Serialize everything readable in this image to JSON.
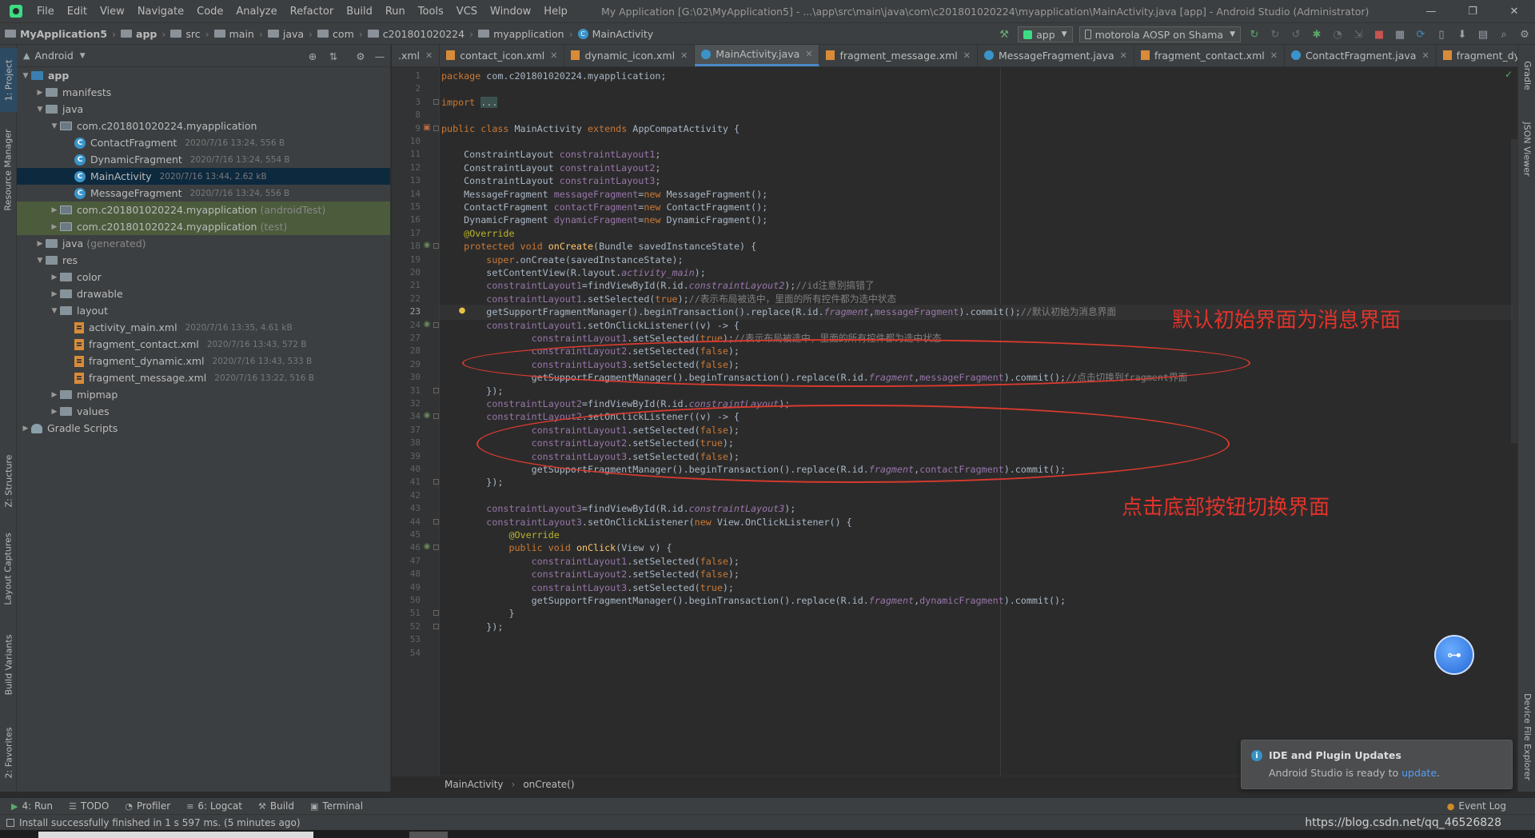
{
  "menubar": {
    "items": [
      "File",
      "Edit",
      "View",
      "Navigate",
      "Code",
      "Analyze",
      "Refactor",
      "Build",
      "Run",
      "Tools",
      "VCS",
      "Window",
      "Help"
    ],
    "window_title": "My Application [G:\\02\\MyApplication5] - ...\\app\\src\\main\\java\\com\\c201801020224\\myapplication\\MainActivity.java [app] - Android Studio (Administrator)",
    "controls": [
      "—",
      "❐",
      "✕"
    ]
  },
  "navbar": {
    "crumbs": [
      "MyApplication5",
      "app",
      "src",
      "main",
      "java",
      "com",
      "c201801020224",
      "myapplication",
      "MainActivity"
    ],
    "run_config": "app",
    "device": "motorola AOSP on Shama"
  },
  "left_strip": {
    "tabs": [
      "1: Project",
      "Resource Manager",
      "Z: Structure",
      "Layout Captures",
      "Build Variants",
      "2: Favorites"
    ]
  },
  "right_strip": {
    "tabs": [
      "Gradle",
      "JSON Viewer",
      "Device File Explorer"
    ]
  },
  "project": {
    "view": "Android",
    "tree": [
      {
        "label": "app",
        "meta": "",
        "suffix": "",
        "level": 0,
        "arrow": "▼",
        "icon": "folder-blue",
        "state": "",
        "bold": true
      },
      {
        "label": "manifests",
        "meta": "",
        "suffix": "",
        "level": 1,
        "arrow": "▶",
        "icon": "folder",
        "state": ""
      },
      {
        "label": "java",
        "meta": "",
        "suffix": "",
        "level": 1,
        "arrow": "▼",
        "icon": "folder",
        "state": ""
      },
      {
        "label": "com.c201801020224.myapplication",
        "meta": "",
        "suffix": "",
        "level": 2,
        "arrow": "▼",
        "icon": "package",
        "state": ""
      },
      {
        "label": "ContactFragment",
        "meta": "2020/7/16 13:24, 556 B",
        "suffix": "",
        "level": 3,
        "arrow": "",
        "icon": "class",
        "state": ""
      },
      {
        "label": "DynamicFragment",
        "meta": "2020/7/16 13:24, 554 B",
        "suffix": "",
        "level": 3,
        "arrow": "",
        "icon": "class",
        "state": ""
      },
      {
        "label": "MainActivity",
        "meta": "2020/7/16 13:44, 2.62 kB",
        "suffix": "",
        "level": 3,
        "arrow": "",
        "icon": "class",
        "state": "sel"
      },
      {
        "label": "MessageFragment",
        "meta": "2020/7/16 13:24, 556 B",
        "suffix": "",
        "level": 3,
        "arrow": "",
        "icon": "class",
        "state": ""
      },
      {
        "label": "com.c201801020224.myapplication",
        "meta": "",
        "suffix": "(androidTest)",
        "level": 2,
        "arrow": "▶",
        "icon": "package",
        "state": "hl"
      },
      {
        "label": "com.c201801020224.myapplication",
        "meta": "",
        "suffix": "(test)",
        "level": 2,
        "arrow": "▶",
        "icon": "package",
        "state": "hl"
      },
      {
        "label": "java",
        "meta": "",
        "suffix": "(generated)",
        "level": 1,
        "arrow": "▶",
        "icon": "folder",
        "state": ""
      },
      {
        "label": "res",
        "meta": "",
        "suffix": "",
        "level": 1,
        "arrow": "▼",
        "icon": "folder",
        "state": ""
      },
      {
        "label": "color",
        "meta": "",
        "suffix": "",
        "level": 2,
        "arrow": "▶",
        "icon": "folder",
        "state": ""
      },
      {
        "label": "drawable",
        "meta": "",
        "suffix": "",
        "level": 2,
        "arrow": "▶",
        "icon": "folder",
        "state": ""
      },
      {
        "label": "layout",
        "meta": "",
        "suffix": "",
        "level": 2,
        "arrow": "▼",
        "icon": "folder",
        "state": ""
      },
      {
        "label": "activity_main.xml",
        "meta": "2020/7/16 13:35, 4.61 kB",
        "suffix": "",
        "level": 3,
        "arrow": "",
        "icon": "xml",
        "state": ""
      },
      {
        "label": "fragment_contact.xml",
        "meta": "2020/7/16 13:43, 572 B",
        "suffix": "",
        "level": 3,
        "arrow": "",
        "icon": "xml",
        "state": ""
      },
      {
        "label": "fragment_dynamic.xml",
        "meta": "2020/7/16 13:43, 533 B",
        "suffix": "",
        "level": 3,
        "arrow": "",
        "icon": "xml",
        "state": ""
      },
      {
        "label": "fragment_message.xml",
        "meta": "2020/7/16 13:22, 516 B",
        "suffix": "",
        "level": 3,
        "arrow": "",
        "icon": "xml",
        "state": ""
      },
      {
        "label": "mipmap",
        "meta": "",
        "suffix": "",
        "level": 2,
        "arrow": "▶",
        "icon": "folder",
        "state": ""
      },
      {
        "label": "values",
        "meta": "",
        "suffix": "",
        "level": 2,
        "arrow": "▶",
        "icon": "folder",
        "state": ""
      },
      {
        "label": "Gradle Scripts",
        "meta": "",
        "suffix": "",
        "level": 0,
        "arrow": "▶",
        "icon": "gradle",
        "state": ""
      }
    ]
  },
  "editor": {
    "tabs": [
      {
        "label": ".xml",
        "type": "none",
        "active": false
      },
      {
        "label": "contact_icon.xml",
        "type": "xml",
        "active": false
      },
      {
        "label": "dynamic_icon.xml",
        "type": "xml",
        "active": false
      },
      {
        "label": "MainActivity.java",
        "type": "java",
        "active": true
      },
      {
        "label": "fragment_message.xml",
        "type": "xml",
        "active": false
      },
      {
        "label": "MessageFragment.java",
        "type": "java",
        "active": false
      },
      {
        "label": "fragment_contact.xml",
        "type": "xml",
        "active": false
      },
      {
        "label": "ContactFragment.java",
        "type": "java",
        "active": false
      },
      {
        "label": "fragment_dynamic.xml",
        "type": "xml",
        "active": false
      }
    ],
    "tab_overflow": "≡2",
    "lines": [
      {
        "n": "1",
        "code": "package com.c201801020224.myapplication;",
        "kind": "plain"
      },
      {
        "n": "2",
        "code": "",
        "kind": "plain"
      },
      {
        "n": "3",
        "code": "import ...",
        "kind": "plain"
      },
      {
        "n": "8",
        "code": "",
        "kind": "plain"
      },
      {
        "n": "9",
        "code": "public class MainActivity extends AppCompatActivity {",
        "kind": "plain"
      },
      {
        "n": "10",
        "code": "",
        "kind": "plain"
      },
      {
        "n": "11",
        "code": "    ConstraintLayout constraintLayout1;",
        "kind": "plain"
      },
      {
        "n": "12",
        "code": "    ConstraintLayout constraintLayout2;",
        "kind": "plain"
      },
      {
        "n": "13",
        "code": "    ConstraintLayout constraintLayout3;",
        "kind": "plain"
      },
      {
        "n": "14",
        "code": "    MessageFragment messageFragment=new MessageFragment();",
        "kind": "plain"
      },
      {
        "n": "15",
        "code": "    ContactFragment contactFragment=new ContactFragment();",
        "kind": "plain"
      },
      {
        "n": "16",
        "code": "    DynamicFragment dynamicFragment=new DynamicFragment();",
        "kind": "plain"
      },
      {
        "n": "17",
        "code": "    @Override",
        "kind": "plain"
      },
      {
        "n": "18",
        "code": "    protected void onCreate(Bundle savedInstanceState) {",
        "kind": "plain"
      },
      {
        "n": "19",
        "code": "        super.onCreate(savedInstanceState);",
        "kind": "plain"
      },
      {
        "n": "20",
        "code": "        setContentView(R.layout.activity_main);",
        "kind": "plain"
      },
      {
        "n": "21",
        "code": "        constraintLayout1=findViewById(R.id.constraintLayout2);//id注意别搞错了",
        "kind": "plain"
      },
      {
        "n": "22",
        "code": "        constraintLayout1.setSelected(true);//表示布局被选中，里面的所有控件都为选中状态",
        "kind": "plain"
      },
      {
        "n": "23",
        "code": "        getSupportFragmentManager().beginTransaction().replace(R.id.fragment,messageFragment).commit();//默认初始为消息界面",
        "kind": "current"
      },
      {
        "n": "24",
        "code": "        constraintLayout1.setOnClickListener((v) -> {",
        "kind": "plain"
      },
      {
        "n": "27",
        "code": "                constraintLayout1.setSelected(true);//表示布局被选中，里面的所有控件都为选中状态",
        "kind": "plain"
      },
      {
        "n": "28",
        "code": "                constraintLayout2.setSelected(false);",
        "kind": "plain"
      },
      {
        "n": "29",
        "code": "                constraintLayout3.setSelected(false);",
        "kind": "plain"
      },
      {
        "n": "30",
        "code": "                getSupportFragmentManager().beginTransaction().replace(R.id.fragment,messageFragment).commit();//点击切换到fragment界面",
        "kind": "plain"
      },
      {
        "n": "31",
        "code": "        });",
        "kind": "plain"
      },
      {
        "n": "32",
        "code": "        constraintLayout2=findViewById(R.id.constraintLayout);",
        "kind": "plain"
      },
      {
        "n": "34",
        "code": "        constraintLayout2.setOnClickListener((v) -> {",
        "kind": "plain"
      },
      {
        "n": "37",
        "code": "                constraintLayout1.setSelected(false);",
        "kind": "plain"
      },
      {
        "n": "38",
        "code": "                constraintLayout2.setSelected(true);",
        "kind": "plain"
      },
      {
        "n": "39",
        "code": "                constraintLayout3.setSelected(false);",
        "kind": "plain"
      },
      {
        "n": "40",
        "code": "                getSupportFragmentManager().beginTransaction().replace(R.id.fragment,contactFragment).commit();",
        "kind": "plain"
      },
      {
        "n": "41",
        "code": "        });",
        "kind": "plain"
      },
      {
        "n": "42",
        "code": "",
        "kind": "plain"
      },
      {
        "n": "43",
        "code": "        constraintLayout3=findViewById(R.id.constraintLayout3);",
        "kind": "plain"
      },
      {
        "n": "44",
        "code": "        constraintLayout3.setOnClickListener(new View.OnClickListener() {",
        "kind": "plain"
      },
      {
        "n": "45",
        "code": "            @Override",
        "kind": "plain"
      },
      {
        "n": "46",
        "code": "            public void onClick(View v) {",
        "kind": "plain"
      },
      {
        "n": "47",
        "code": "                constraintLayout1.setSelected(false);",
        "kind": "plain"
      },
      {
        "n": "48",
        "code": "                constraintLayout2.setSelected(false);",
        "kind": "plain"
      },
      {
        "n": "49",
        "code": "                constraintLayout3.setSelected(true);",
        "kind": "plain"
      },
      {
        "n": "50",
        "code": "                getSupportFragmentManager().beginTransaction().replace(R.id.fragment,dynamicFragment).commit();",
        "kind": "plain"
      },
      {
        "n": "51",
        "code": "            }",
        "kind": "plain"
      },
      {
        "n": "52",
        "code": "        });",
        "kind": "plain"
      },
      {
        "n": "53",
        "code": "",
        "kind": "plain"
      },
      {
        "n": "54",
        "code": "",
        "kind": "plain"
      }
    ],
    "annotations": {
      "note1": "默认初始界面为消息界面",
      "note2": "点击底部按钮切换界面"
    },
    "breadcrumb": [
      "MainActivity",
      "onCreate()"
    ]
  },
  "tool_windows": {
    "tabs": [
      {
        "icon": "▶",
        "label": "4: Run"
      },
      {
        "icon": "☰",
        "label": "TODO"
      },
      {
        "icon": "◔",
        "label": "Profiler"
      },
      {
        "icon": "≡",
        "label": "6: Logcat"
      },
      {
        "icon": "⚒",
        "label": "Build"
      },
      {
        "icon": "▣",
        "label": "Terminal"
      }
    ],
    "event_log": "Event Log"
  },
  "status": {
    "message": "Install successfully finished in 1 s 597 ms. (5 minutes ago)",
    "watermark": "https://blog.csdn.net/qq_46526828"
  },
  "notification": {
    "title": "IDE and Plugin Updates",
    "body": "Android Studio is ready to",
    "link": "update",
    "tail": "."
  },
  "colors": {
    "keyword": "#cc7832",
    "field": "#9876aa",
    "annotation": "#bbb529",
    "comment": "#808080",
    "method": "#ffc66d",
    "accent": "#4a88c7",
    "ellipse": "#d93a2e"
  }
}
